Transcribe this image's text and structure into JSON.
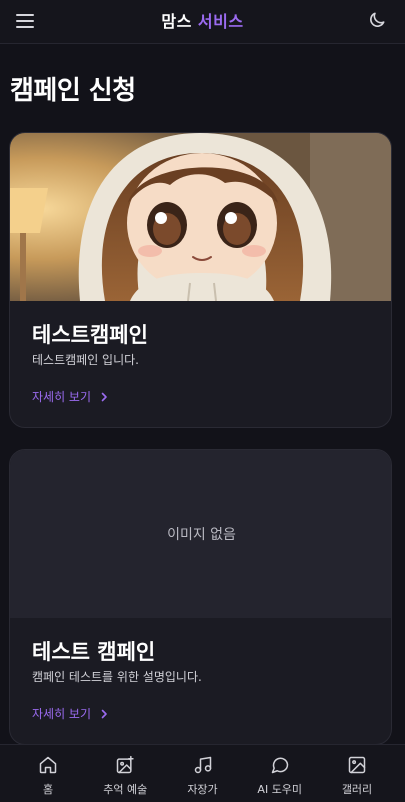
{
  "header": {
    "brand_part1": "맘스",
    "brand_part2": "서비스",
    "menu_icon": "hamburger-menu-icon",
    "theme_icon": "moon-icon"
  },
  "page": {
    "title": "캠페인 신청"
  },
  "campaigns": [
    {
      "title": "테스트캠페인",
      "description": "테스트캠페인 입니다.",
      "link_label": "자세히 보기",
      "has_image": true
    },
    {
      "title": "테스트 캠페인",
      "description": "캠페인 테스트를 위한 설명입니다.",
      "link_label": "자세히 보기",
      "has_image": false,
      "no_image_text": "이미지 없음"
    }
  ],
  "bottom_nav": [
    {
      "label": "홈",
      "icon": "home-icon"
    },
    {
      "label": "추억 예술",
      "icon": "image-sparkle-icon"
    },
    {
      "label": "자장가",
      "icon": "music-note-icon"
    },
    {
      "label": "AI 도우미",
      "icon": "chat-bubble-icon"
    },
    {
      "label": "갤러리",
      "icon": "gallery-icon"
    }
  ],
  "colors": {
    "accent": "#9b6bf0",
    "background": "#121219",
    "card": "#1b1b23"
  }
}
